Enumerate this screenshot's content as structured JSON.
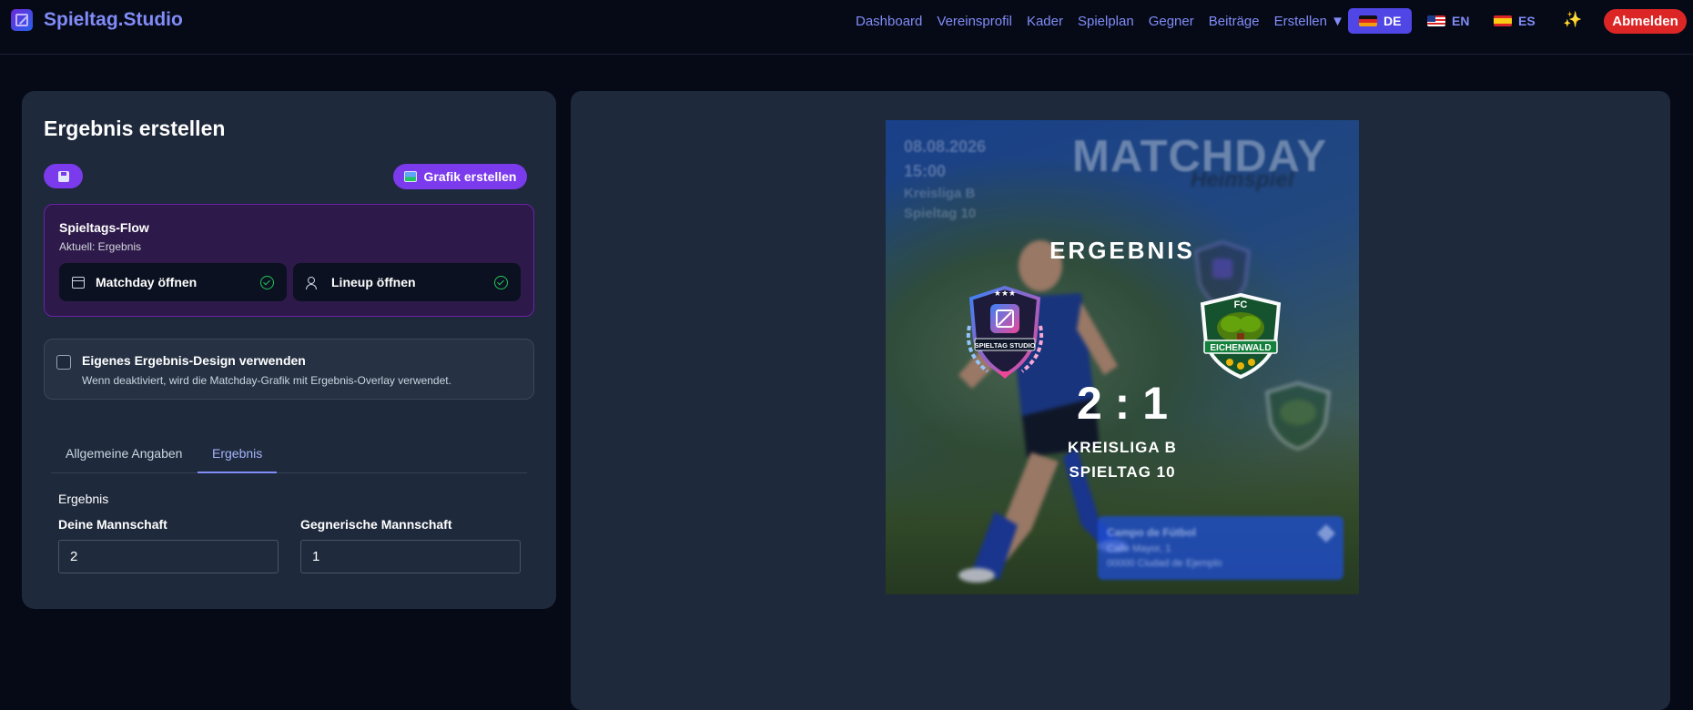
{
  "nav": {
    "brand": "Spieltag.Studio",
    "links": [
      "Dashboard",
      "Vereinsprofil",
      "Kader",
      "Spielplan",
      "Gegner",
      "Beiträge",
      "Erstellen ▼"
    ],
    "languages": [
      {
        "code": "DE",
        "active": true
      },
      {
        "code": "EN",
        "active": false
      },
      {
        "code": "ES",
        "active": false
      }
    ],
    "sparkle_icon": "✨",
    "logout_label": "Abmelden"
  },
  "editor": {
    "title": "Ergebnis erstellen",
    "save_icon": "floppy-disk-icon",
    "create_graphic_label": "Grafik erstellen",
    "flow": {
      "title": "Spieltags-Flow",
      "subtitle": "Aktuell: Ergebnis",
      "matchday_label": "Matchday öffnen",
      "lineup_label": "Lineup öffnen"
    },
    "custom_design": {
      "label": "Eigenes Ergebnis-Design verwenden",
      "hint": "Wenn deaktiviert, wird die Matchday-Grafik mit Ergebnis-Overlay verwendet.",
      "checked": false
    },
    "tabs": [
      "Allgemeine Angaben",
      "Ergebnis"
    ],
    "active_tab": "Ergebnis",
    "section_title": "Ergebnis",
    "own_team_label": "Deine Mannschaft",
    "own_team_value": "2",
    "opponent_label": "Gegnerische Mannschaft",
    "opponent_value": "1"
  },
  "preview": {
    "bg_date": "08.08.2026",
    "bg_time": "15:00",
    "bg_league": "Kreisliga B",
    "bg_matchday": "Spieltag 10",
    "bg_title": "MATCHDAY",
    "bg_subtitle": "Heimspiel",
    "result_heading": "ERGEBNIS",
    "score": "2 : 1",
    "league": "KREISLIGA B",
    "matchday": "SPIELTAG 10",
    "home_crest_text": "SPIELTAG STUDIO",
    "away_crest_top": "FC",
    "away_crest_name": "EICHENWALD",
    "venue_name": "Campo de Fútbol",
    "venue_street": "Calle Mayor, 1",
    "venue_city": "00000 Ciudad de Ejemplo"
  },
  "colors": {
    "accent": "#7c3aed",
    "nav_link": "#818cf8",
    "logout": "#dc2626",
    "panel": "#1e293b",
    "page_bg": "#060a17"
  }
}
